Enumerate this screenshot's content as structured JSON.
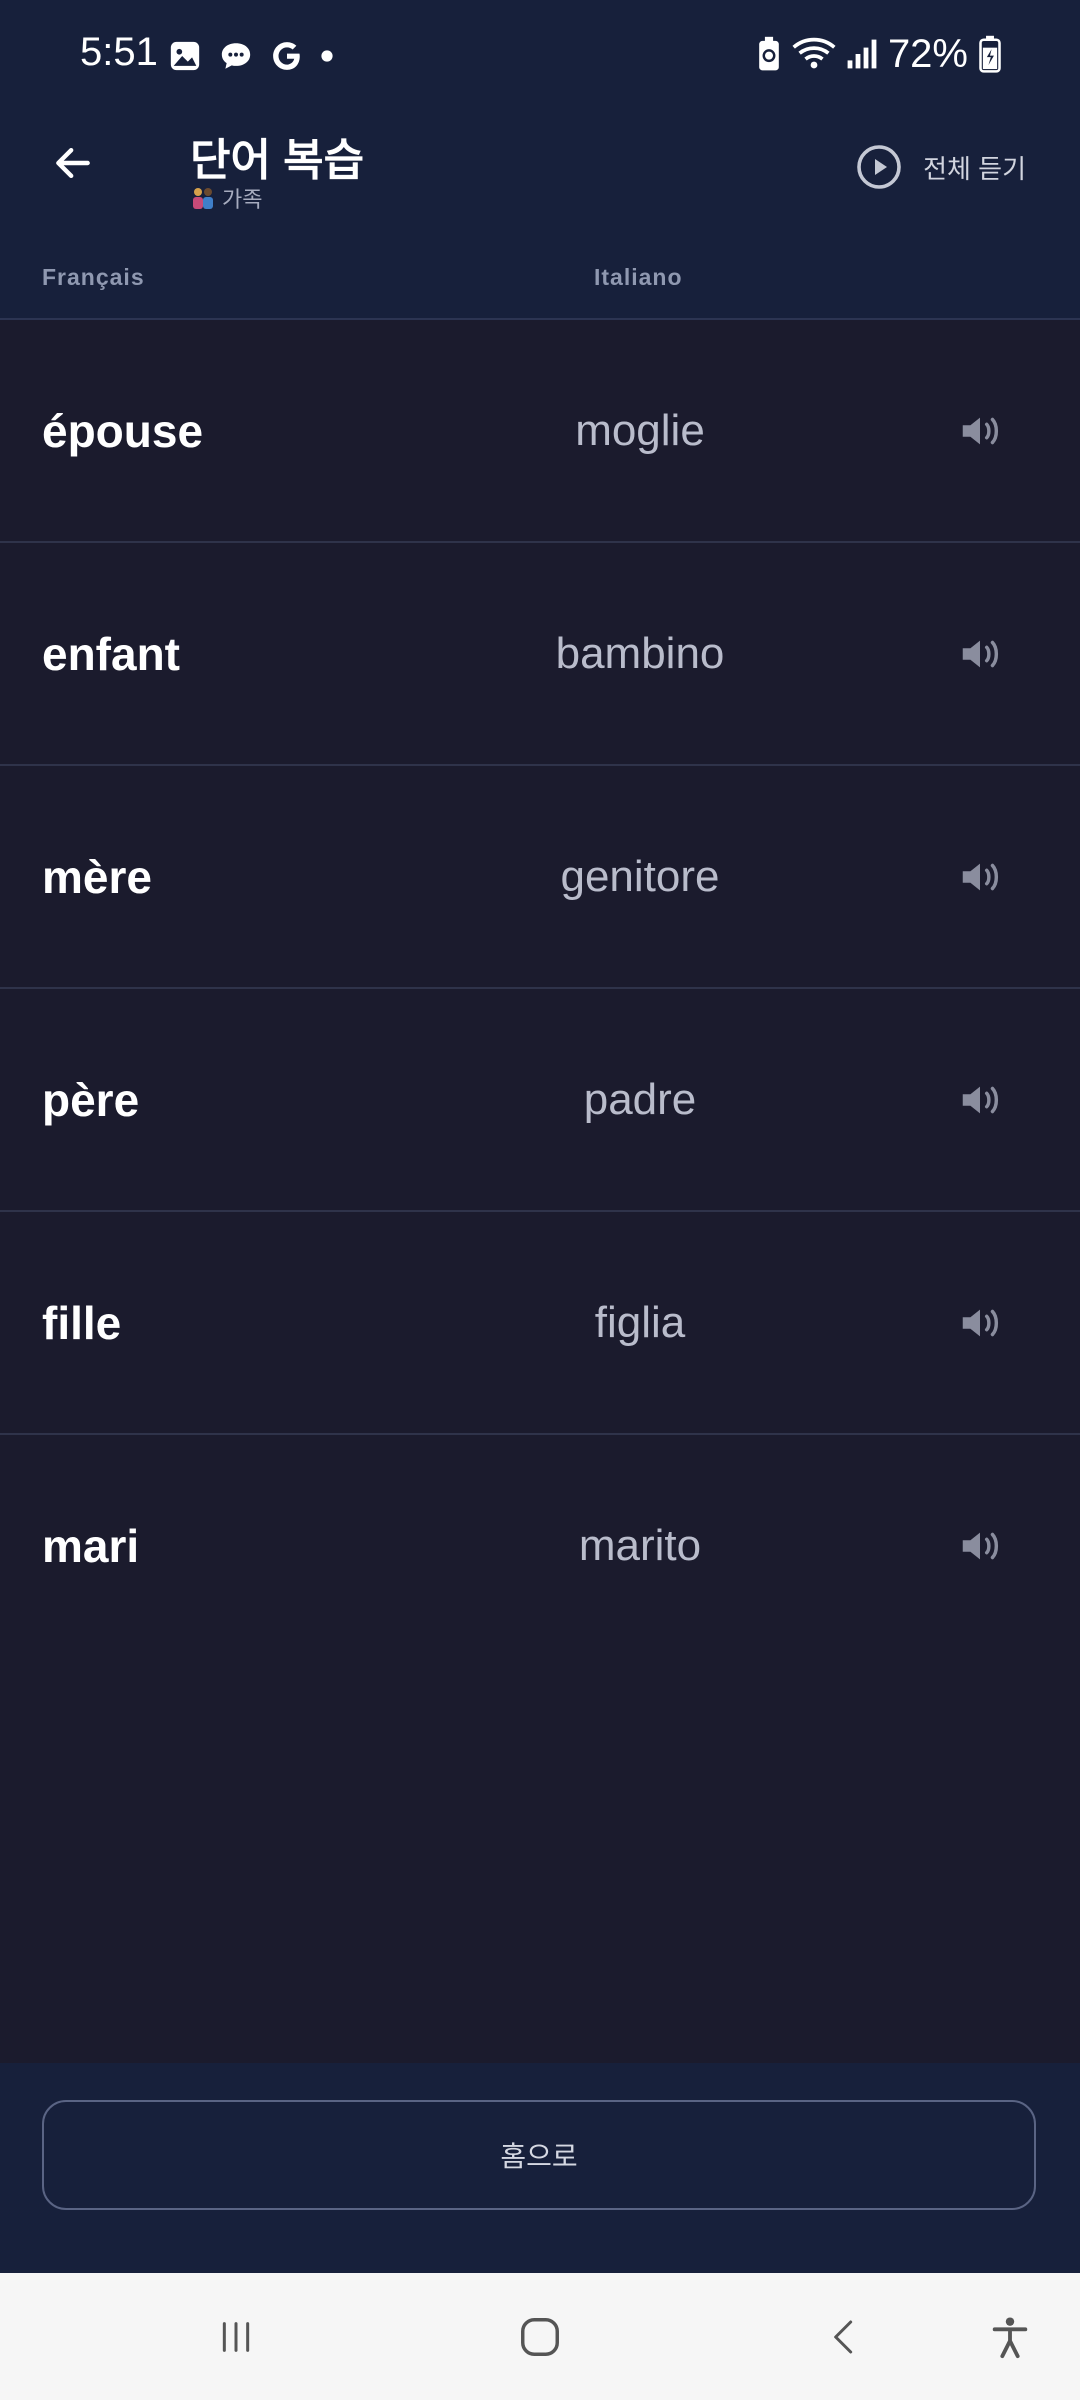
{
  "status": {
    "time": "5:51",
    "battery_pct": "72%",
    "left_icons": [
      "gallery-icon",
      "messages-icon",
      "google-icon",
      "dot-icon"
    ],
    "right_icons": [
      "battery-saver-icon",
      "wifi-icon",
      "signal-icon",
      "battery-icon"
    ]
  },
  "header": {
    "title": "단어 복습",
    "subtitle": "가족",
    "play_all_label": "전체 듣기",
    "col_fr": "Français",
    "col_it": "Italiano"
  },
  "words": [
    {
      "fr": "épouse",
      "it": "moglie"
    },
    {
      "fr": "enfant",
      "it": "bambino"
    },
    {
      "fr": "mère",
      "it": "genitore"
    },
    {
      "fr": "père",
      "it": "padre"
    },
    {
      "fr": "fille",
      "it": "figlia"
    },
    {
      "fr": "mari",
      "it": "marito"
    }
  ],
  "footer": {
    "home_label": "홈으로"
  },
  "nav": [
    "recent-apps-icon",
    "home-icon",
    "back-icon",
    "accessibility-icon"
  ],
  "colors": {
    "header_bg": "#17203b",
    "list_bg": "#1b1b2d",
    "divider": "#2f334a",
    "accent_text": "#b9bccb"
  }
}
